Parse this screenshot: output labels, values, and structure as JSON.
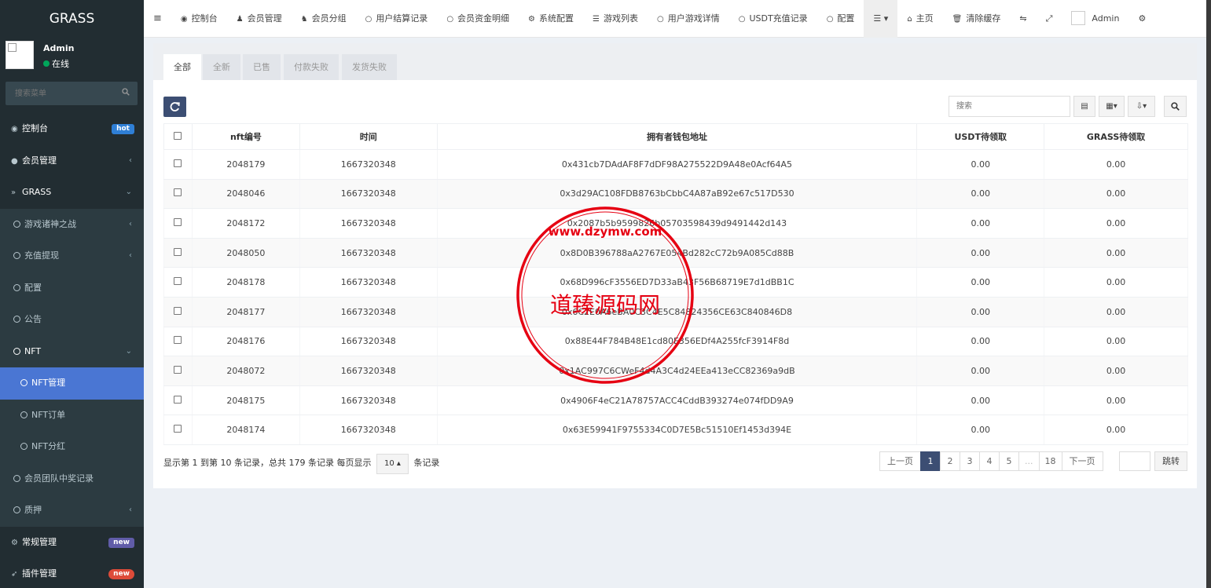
{
  "sidebar": {
    "logo": "GRASS",
    "user": {
      "name": "Admin",
      "status": "在线"
    },
    "search_placeholder": "搜索菜单",
    "items": [
      {
        "label": "控制台",
        "badge": "hot"
      },
      {
        "label": "会员管理"
      },
      {
        "label": "GRASS"
      },
      {
        "label": "游戏诸神之战"
      },
      {
        "label": "充值提现"
      },
      {
        "label": "配置"
      },
      {
        "label": "公告"
      },
      {
        "label": "NFT"
      },
      {
        "label": "NFT管理"
      },
      {
        "label": "NFT订单"
      },
      {
        "label": "NFT分红"
      },
      {
        "label": "会员团队中奖记录"
      },
      {
        "label": "质押"
      },
      {
        "label": "常规管理",
        "badge": "new"
      },
      {
        "label": "插件管理",
        "badge": "new"
      }
    ]
  },
  "topnav": {
    "items": [
      "控制台",
      "会员管理",
      "会员分组",
      "用户结算记录",
      "会员资金明细",
      "系统配置",
      "游戏列表",
      "用户游戏详情",
      "USDT充值记录",
      "配置"
    ],
    "home": "主页",
    "clear_cache": "清除缓存",
    "admin": "Admin"
  },
  "tabs": [
    "全部",
    "全新",
    "已售",
    "付款失败",
    "发货失败"
  ],
  "toolbar": {
    "search_placeholder": "搜索"
  },
  "table": {
    "headers": [
      "nft编号",
      "时间",
      "拥有者钱包地址",
      "USDT待领取",
      "GRASS待领取"
    ],
    "rows": [
      {
        "id": "2048179",
        "time": "1667320348",
        "wallet": "0x431cb7DAdAF8F7dDF98A275522D9A48e0Acf64A5",
        "usdt": "0.00",
        "grass": "0.00"
      },
      {
        "id": "2048046",
        "time": "1667320348",
        "wallet": "0x3d29AC108FDB8763bCbbC4A87aB92e67c517D530",
        "usdt": "0.00",
        "grass": "0.00"
      },
      {
        "id": "2048172",
        "time": "1667320348",
        "wallet": "0x2087b5b9599826b05703598439d9491442d143",
        "usdt": "0.00",
        "grass": "0.00"
      },
      {
        "id": "2048050",
        "time": "1667320348",
        "wallet": "0x8D0B396788aA2767E054Bd282cC72b9A085Cd88B",
        "usdt": "0.00",
        "grass": "0.00"
      },
      {
        "id": "2048178",
        "time": "1667320348",
        "wallet": "0x68D996cF3556ED7D33aB43F56B68719E7d1dBB1C",
        "usdt": "0.00",
        "grass": "0.00"
      },
      {
        "id": "2048177",
        "time": "1667320348",
        "wallet": "0x6C2E0A6eBA0C3C4E5C84824356CE63C840846D8",
        "usdt": "0.00",
        "grass": "0.00"
      },
      {
        "id": "2048176",
        "time": "1667320348",
        "wallet": "0x88E44F784B48E1cd80E356EDf4A255fcF3914F8d",
        "usdt": "0.00",
        "grass": "0.00"
      },
      {
        "id": "2048072",
        "time": "1667320348",
        "wallet": "0x1AC997C6CWeF4d4A3C4d24EEa413eCC82369a9dB",
        "usdt": "0.00",
        "grass": "0.00"
      },
      {
        "id": "2048175",
        "time": "1667320348",
        "wallet": "0x4906F4eC21A78757ACC4CddB393274e074fDD9A9",
        "usdt": "0.00",
        "grass": "0.00"
      },
      {
        "id": "2048174",
        "time": "1667320348",
        "wallet": "0x63E59941F9755334C0D7E5Bc51510Ef1453d394E",
        "usdt": "0.00",
        "grass": "0.00"
      }
    ]
  },
  "footer": {
    "summary_prefix": "显示第 1 到第 10 条记录，总共 179 条记录 每页显示",
    "page_size": "10",
    "summary_suffix": "条记录"
  },
  "pagination": {
    "prev": "上一页",
    "pages": [
      "1",
      "2",
      "3",
      "4",
      "5",
      "...",
      "18"
    ],
    "next": "下一页",
    "jump": "跳转"
  },
  "watermark": {
    "text": "道臻源码网",
    "url": "www.dzymw.com"
  },
  "colors": {
    "sidebar_bg": "#222d32",
    "active": "#4a76d3",
    "stamp": "#e60012"
  }
}
